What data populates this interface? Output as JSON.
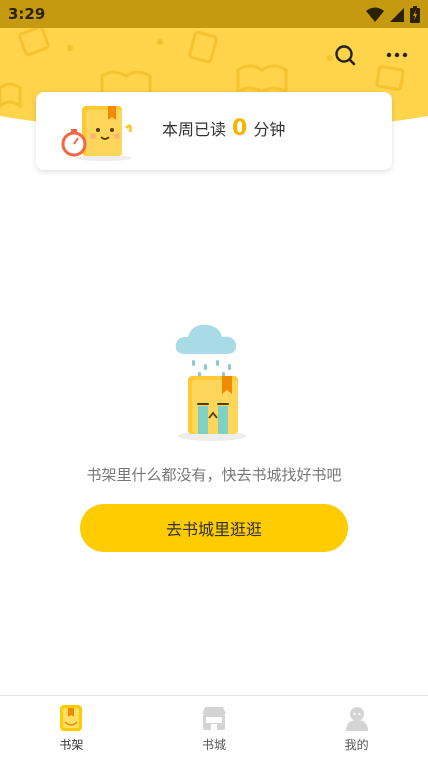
{
  "status_bar": {
    "time": "3:29"
  },
  "header": {
    "actions": [
      "search-icon",
      "more-icon"
    ]
  },
  "reading_card": {
    "prefix": "本周已读",
    "count": "0",
    "suffix": "分钟"
  },
  "empty_state": {
    "message": "书架里什么都没有，快去书城找好书吧",
    "button_label": "去书城里逛逛"
  },
  "bottom_nav": {
    "items": [
      {
        "label": "书架",
        "icon": "bookshelf-icon",
        "active": true
      },
      {
        "label": "书城",
        "icon": "bookstore-icon",
        "active": false
      },
      {
        "label": "我的",
        "icon": "profile-icon",
        "active": false
      }
    ]
  },
  "colors": {
    "accent": "#ffcc00",
    "header": "#ffd34a",
    "status_bar": "#c59a10",
    "count": "#f5b400"
  }
}
